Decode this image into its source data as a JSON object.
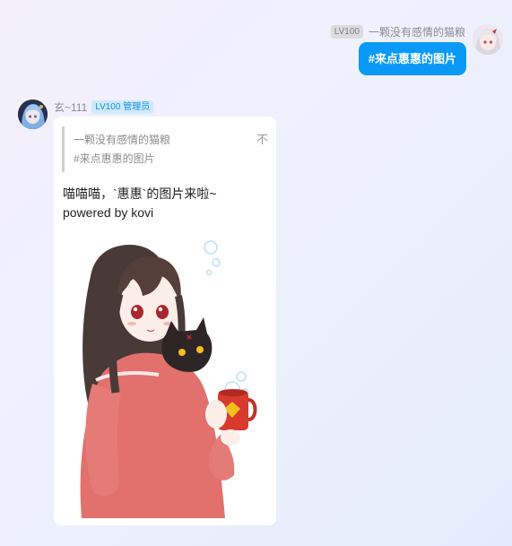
{
  "outgoing": {
    "level": "LV100",
    "nickname": "一颗没有感情的猫粮",
    "text": "#来点惠惠的图片",
    "bubble_color": "#0a99f7"
  },
  "incoming": {
    "nickname": "玄~111",
    "badge": "LV100 管理员",
    "badge_color": "#1a8ee6",
    "quote": {
      "name": "一颗没有感情的猫粮",
      "text": "#来点惠惠的图片",
      "icon": "不"
    },
    "lines": [
      "喵喵喵，`惠惠`的图片来啦~",
      "powered by kovi"
    ],
    "image": {
      "subject": "anime girl with dark cat holding a red mug"
    }
  }
}
